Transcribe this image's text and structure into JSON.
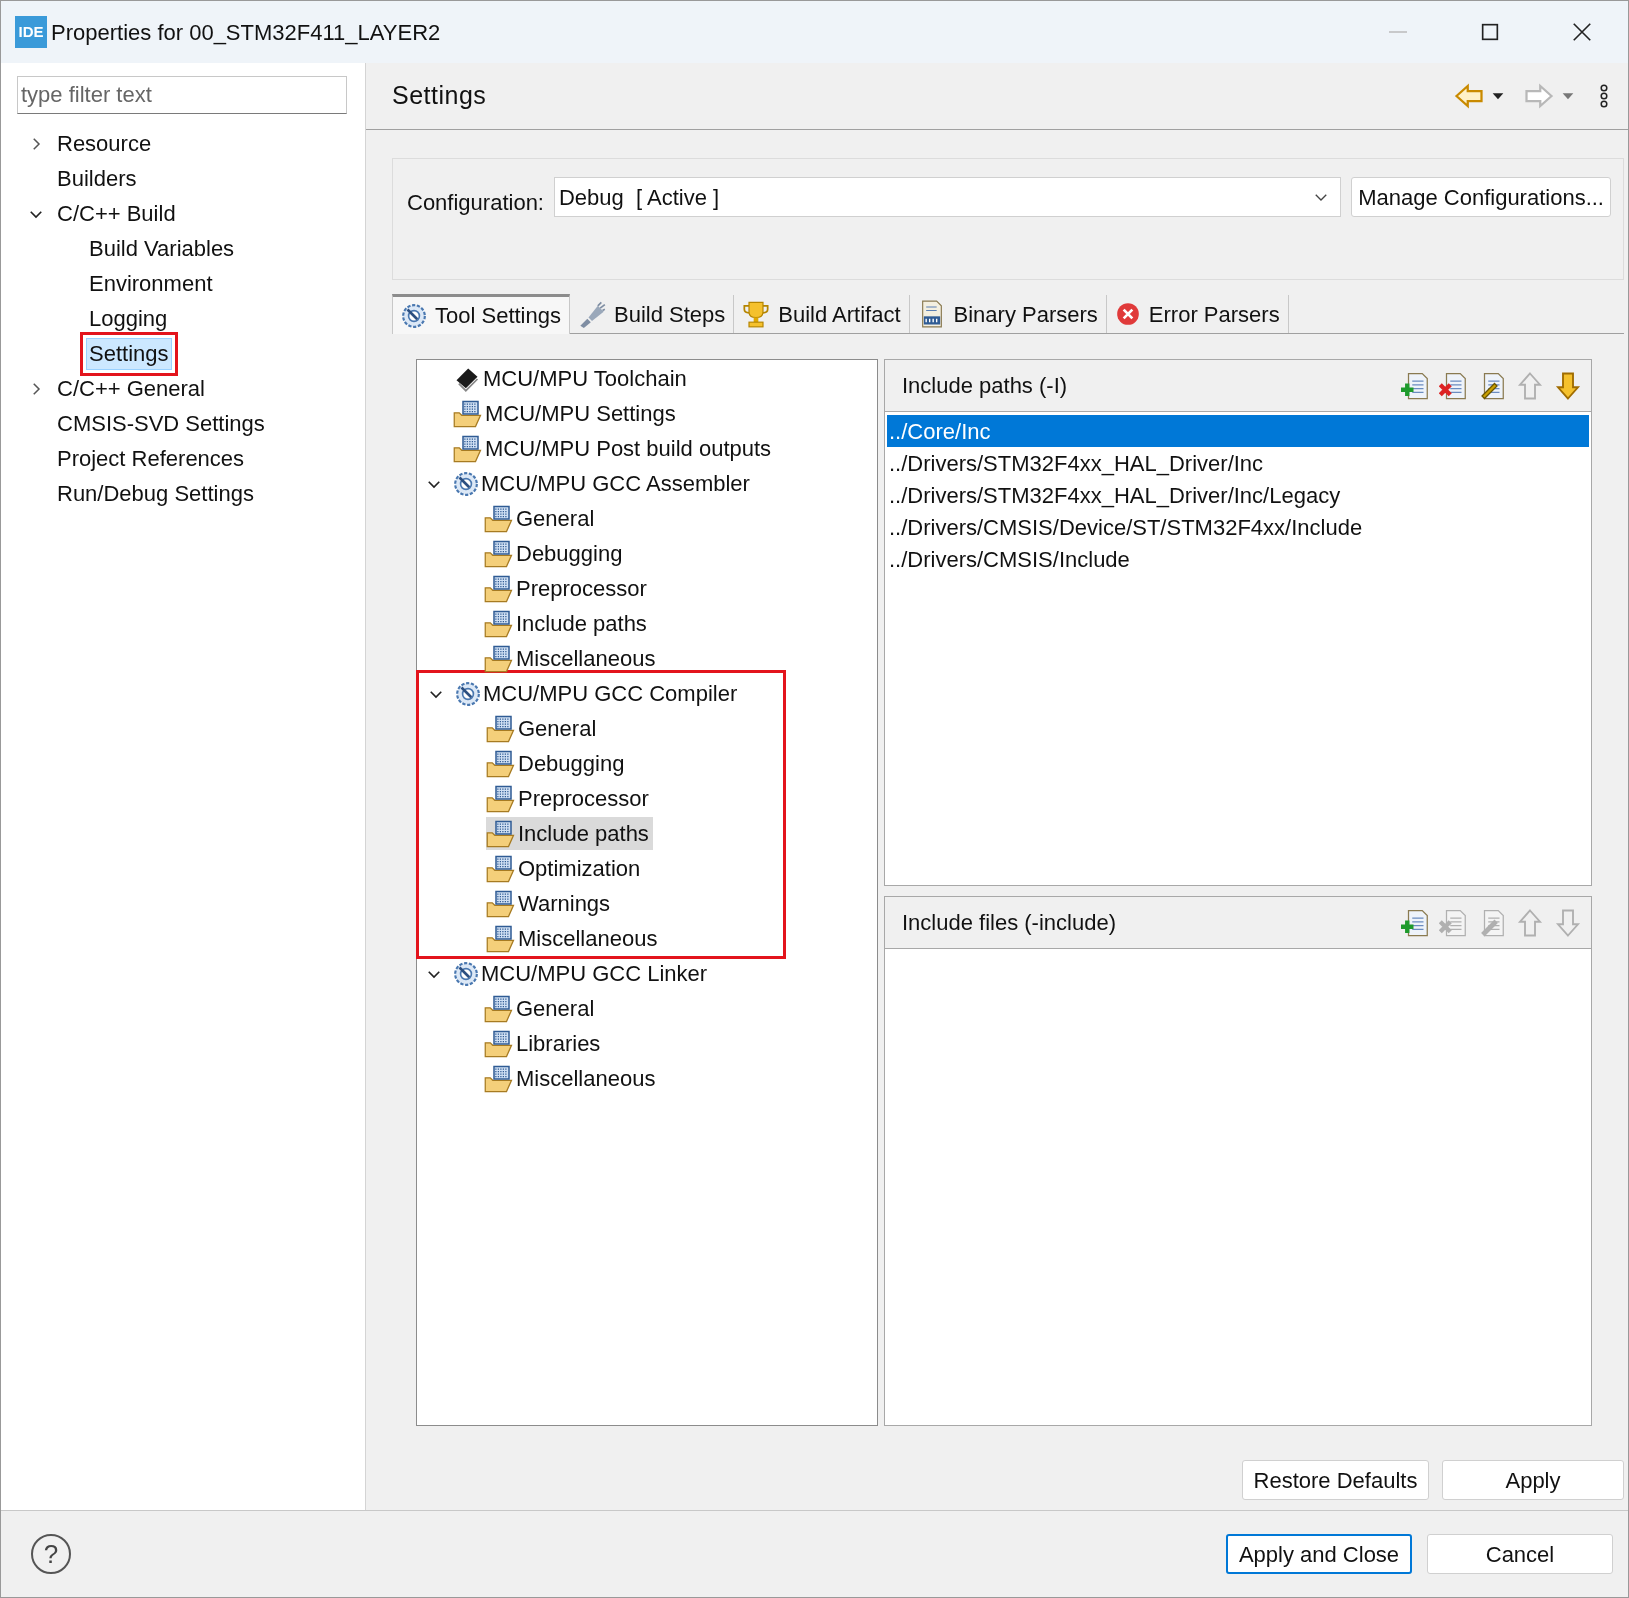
{
  "window": {
    "icon_label": "IDE",
    "title": "Properties for 00_STM32F411_LAYER2",
    "controls": [
      {
        "kind": "minimize",
        "disabled": true
      },
      {
        "kind": "maximize",
        "disabled": false
      },
      {
        "kind": "close",
        "disabled": false
      }
    ]
  },
  "filter": {
    "placeholder": "type filter text"
  },
  "nav_tree": [
    {
      "label": "Resource",
      "expanded": false,
      "selected": false
    },
    {
      "label": "Builders",
      "selected": false
    },
    {
      "label": "C/C++ Build",
      "expanded": true,
      "selected": false,
      "children": [
        {
          "label": "Build Variables",
          "selected": false
        },
        {
          "label": "Environment",
          "selected": false
        },
        {
          "label": "Logging",
          "selected": false
        },
        {
          "label": "Settings",
          "selected": true,
          "highlighted": true
        }
      ]
    },
    {
      "label": "C/C++ General",
      "expanded": false,
      "selected": false
    },
    {
      "label": "CMSIS-SVD Settings",
      "selected": false
    },
    {
      "label": "Project References",
      "selected": false
    },
    {
      "label": "Run/Debug Settings",
      "selected": false
    }
  ],
  "page": {
    "title": "Settings",
    "back": {
      "disabled": false
    },
    "forward": {
      "disabled": true
    }
  },
  "configuration": {
    "label": "Configuration:",
    "value": "Debug  [ Active ]",
    "button": "Manage Configurations..."
  },
  "tabs": [
    {
      "label": "Tool Settings",
      "kind": "tool",
      "selected": true
    },
    {
      "label": "Build Steps",
      "kind": "steps",
      "selected": false
    },
    {
      "label": "Build Artifact",
      "kind": "artifact",
      "selected": false
    },
    {
      "label": "Binary Parsers",
      "kind": "binary",
      "selected": false
    },
    {
      "label": "Error Parsers",
      "kind": "error",
      "selected": false
    }
  ],
  "tool_tree": [
    {
      "label": "MCU/MPU Toolchain",
      "kind": "toolchain",
      "selected": false
    },
    {
      "label": "MCU/MPU Settings",
      "kind": "category",
      "selected": false
    },
    {
      "label": "MCU/MPU Post build outputs",
      "kind": "category",
      "selected": false
    },
    {
      "label": "MCU/MPU GCC Assembler",
      "kind": "tool",
      "expanded": true,
      "selected": false,
      "children": [
        {
          "label": "General",
          "kind": "category",
          "selected": false
        },
        {
          "label": "Debugging",
          "kind": "category",
          "selected": false
        },
        {
          "label": "Preprocessor",
          "kind": "category",
          "selected": false
        },
        {
          "label": "Include paths",
          "kind": "category",
          "selected": false
        },
        {
          "label": "Miscellaneous",
          "kind": "category",
          "selected": false
        }
      ]
    },
    {
      "label": "MCU/MPU GCC Compiler",
      "kind": "tool",
      "expanded": true,
      "selected": false,
      "highlighted": true,
      "children": [
        {
          "label": "General",
          "kind": "category",
          "selected": false
        },
        {
          "label": "Debugging",
          "kind": "category",
          "selected": false
        },
        {
          "label": "Preprocessor",
          "kind": "category",
          "selected": false
        },
        {
          "label": "Include paths",
          "kind": "category",
          "selected": true
        },
        {
          "label": "Optimization",
          "kind": "category",
          "selected": false
        },
        {
          "label": "Warnings",
          "kind": "category",
          "selected": false
        },
        {
          "label": "Miscellaneous",
          "kind": "category",
          "selected": false
        }
      ]
    },
    {
      "label": "MCU/MPU GCC Linker",
      "kind": "tool",
      "expanded": true,
      "selected": false,
      "children": [
        {
          "label": "General",
          "kind": "category",
          "selected": false
        },
        {
          "label": "Libraries",
          "kind": "category",
          "selected": false
        },
        {
          "label": "Miscellaneous",
          "kind": "category",
          "selected": false
        }
      ]
    }
  ],
  "include_paths": {
    "title": "Include paths (-I)",
    "toolbar": [
      {
        "kind": "add",
        "disabled": false
      },
      {
        "kind": "delete",
        "disabled": false
      },
      {
        "kind": "edit",
        "disabled": false
      },
      {
        "kind": "up",
        "disabled": true
      },
      {
        "kind": "down",
        "disabled": false
      }
    ],
    "items": [
      {
        "text": "../Core/Inc",
        "selected": true
      },
      {
        "text": "../Drivers/STM32F4xx_HAL_Driver/Inc",
        "selected": false
      },
      {
        "text": "../Drivers/STM32F4xx_HAL_Driver/Inc/Legacy",
        "selected": false
      },
      {
        "text": "../Drivers/CMSIS/Device/ST/STM32F4xx/Include",
        "selected": false
      },
      {
        "text": "../Drivers/CMSIS/Include",
        "selected": false
      }
    ]
  },
  "include_files": {
    "title": "Include files (-include)",
    "toolbar": [
      {
        "kind": "add",
        "disabled": false
      },
      {
        "kind": "delete",
        "disabled": true
      },
      {
        "kind": "edit",
        "disabled": true
      },
      {
        "kind": "up",
        "disabled": true
      },
      {
        "kind": "down",
        "disabled": true
      }
    ]
  },
  "page_buttons": [
    {
      "label": "Restore Defaults"
    },
    {
      "label": "Apply"
    }
  ],
  "help": {
    "glyph": "?"
  },
  "dialog_buttons": [
    {
      "label": "Apply and Close",
      "default": true
    },
    {
      "label": "Cancel",
      "default": false
    }
  ]
}
